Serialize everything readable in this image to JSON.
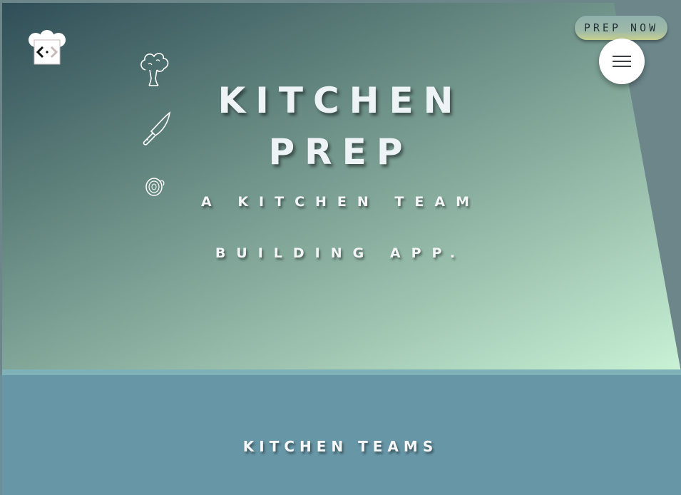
{
  "hero": {
    "title_line1": "KITCHEN",
    "title_line2": "PREP",
    "subtitle_line1": "A KITCHEN TEAM",
    "subtitle_line2": "BUILDING APP."
  },
  "header": {
    "logo_icon": "chef-hat-code-icon",
    "cta_label": "PREP NOW",
    "menu_icon": "hamburger-menu-icon"
  },
  "decorations": [
    "broccoli-icon",
    "knife-icon",
    "onion-icon"
  ],
  "sections": {
    "teams_title": "KITCHEN TEAMS"
  },
  "colors": {
    "hero_gradient_start": "#2f4e58",
    "hero_gradient_end": "#c9f2d6",
    "lower_background": "#6796a6",
    "divider": "#7fb1b9",
    "text": "#eef3f6"
  }
}
